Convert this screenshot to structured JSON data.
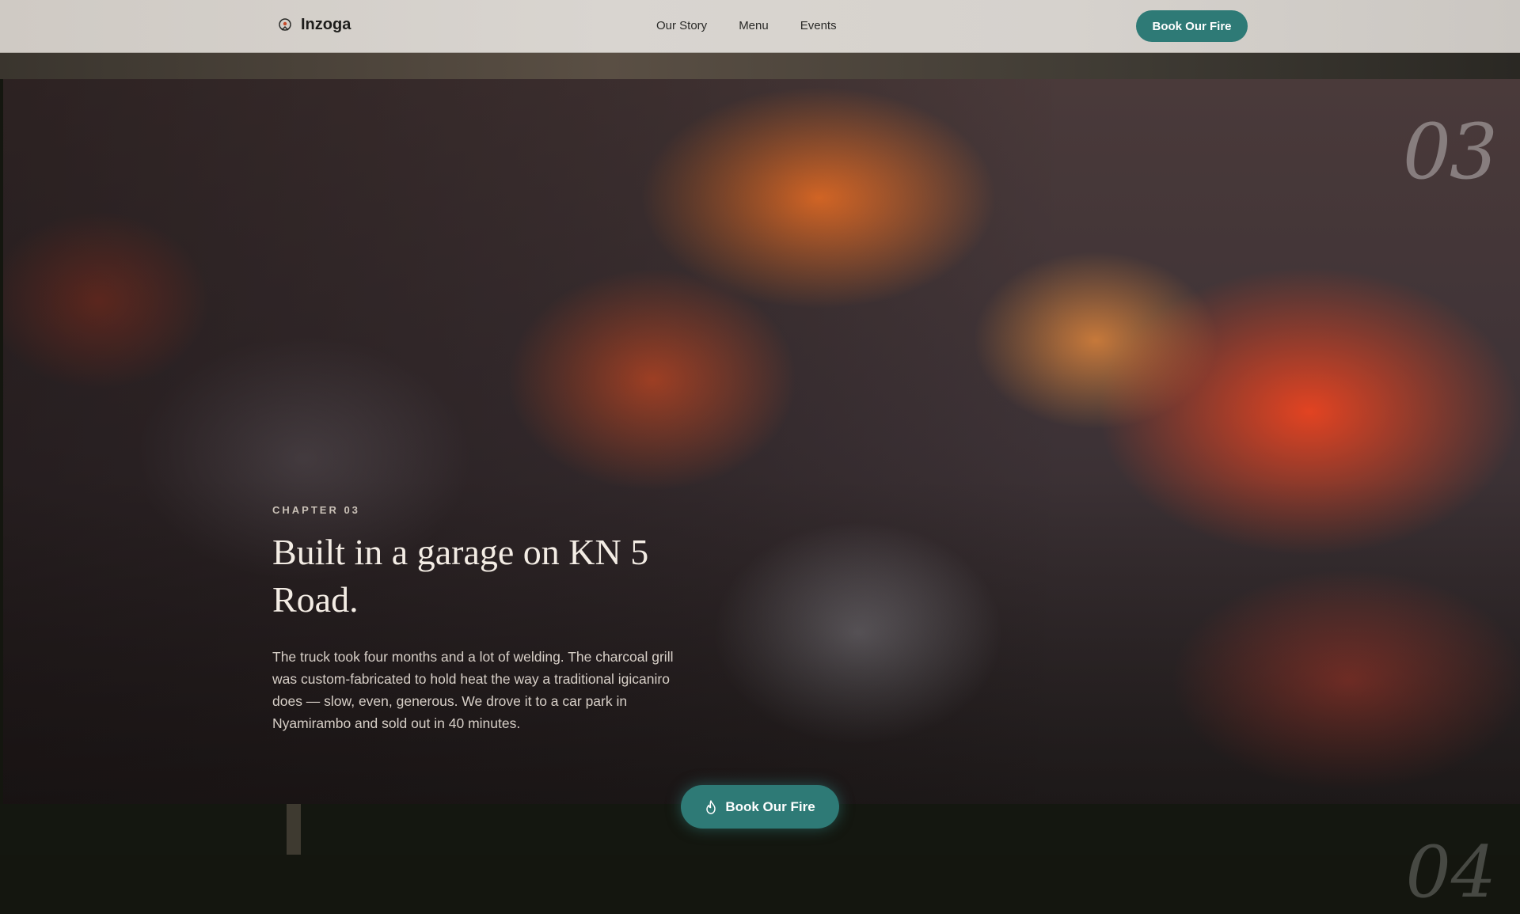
{
  "nav": {
    "brand": "Inzoga",
    "links": [
      "Our Story",
      "Menu",
      "Events"
    ],
    "cta_label": "Book Our Fire"
  },
  "hero": {
    "chapter_number": "03",
    "eyebrow": "CHAPTER 03",
    "title": "Built in a garage on KN 5 Road.",
    "body": "The truck took four months and a lot of welding. The charcoal grill was custom-fabricated to hold heat the way a traditional igicaniro does — slow, even, generous. We drove it to a car park in Nyamirambo and sold out in 40 minutes."
  },
  "next_section": {
    "chapter_number": "04"
  },
  "floating_cta": {
    "label": "Book Our Fire",
    "icon": "flame-icon"
  },
  "colors": {
    "accent": "#2e7a76",
    "nav_bg": "#d6d2cd",
    "page_bg": "#14160f"
  }
}
